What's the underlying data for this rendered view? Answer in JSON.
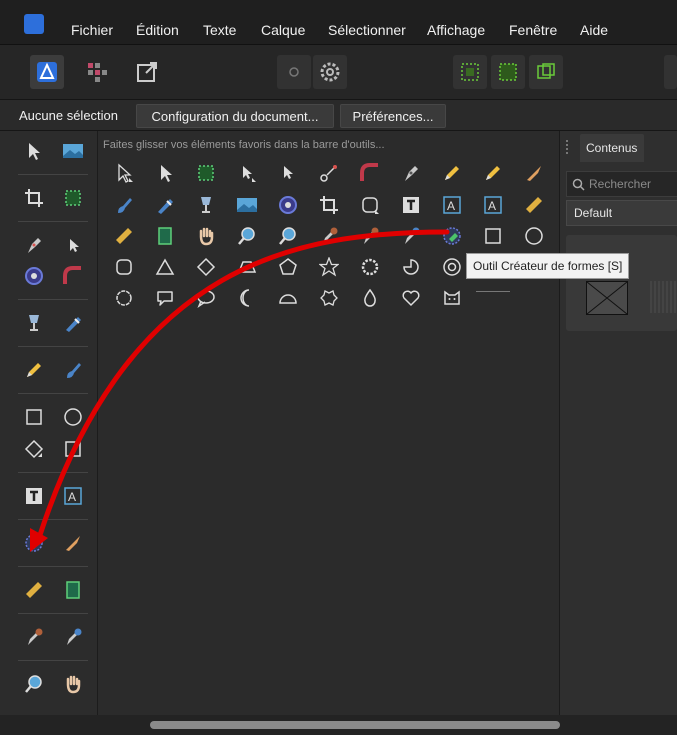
{
  "menubar": {
    "items": [
      "Fichier",
      "Édition",
      "Texte",
      "Calque",
      "Sélectionner",
      "Affichage",
      "Fenêtre",
      "Aide"
    ]
  },
  "contextbar": {
    "selection_label": "Aucune sélection",
    "doc_setup_label": "Configuration du document...",
    "prefs_label": "Préférences..."
  },
  "customize": {
    "hint": "Faites glisser vos éléments favoris dans la barre d'outils..."
  },
  "rightpanel": {
    "tab_label": "Contenus",
    "search_placeholder": "Rechercher",
    "category_value": "Default"
  },
  "tooltip": {
    "text": "Outil Créateur de formes [S]"
  },
  "colors": {
    "accent": "#2d6fdb",
    "annotation_arrow": "#e00000"
  }
}
